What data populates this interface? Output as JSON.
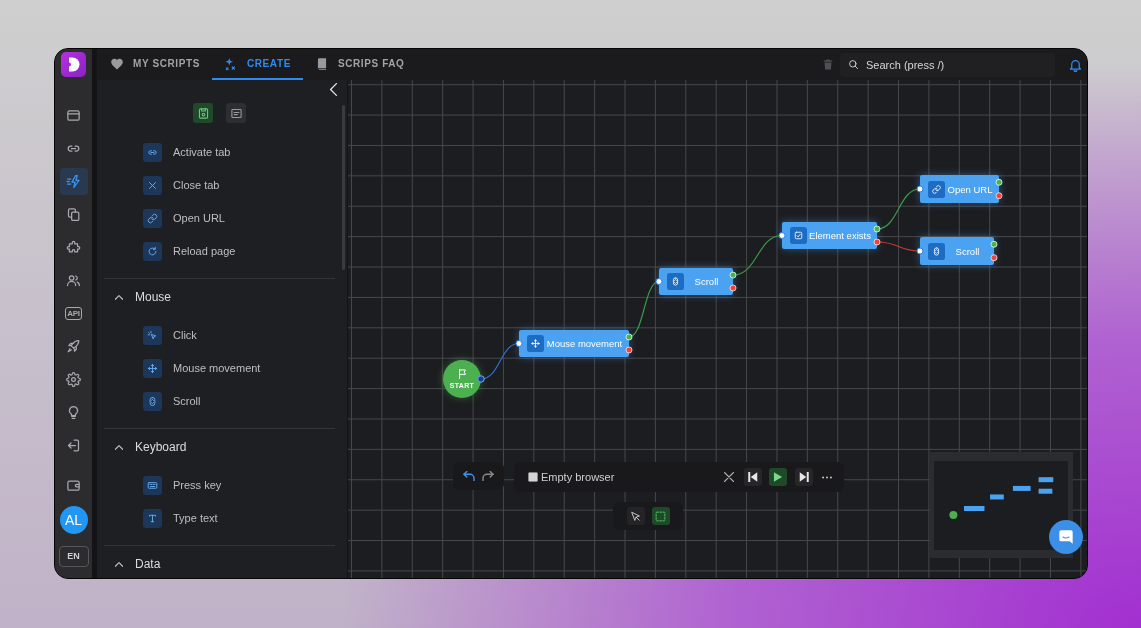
{
  "rail": {
    "items": [
      {
        "kind": "window",
        "selected": false
      },
      {
        "kind": "link",
        "selected": false
      },
      {
        "kind": "lightning",
        "selected": true
      },
      {
        "kind": "copy",
        "selected": false
      },
      {
        "kind": "puzzle",
        "selected": false
      },
      {
        "kind": "users",
        "selected": false
      },
      {
        "kind": "api",
        "label": "API",
        "selected": false
      },
      {
        "kind": "rocket",
        "selected": false
      },
      {
        "kind": "gear",
        "selected": false
      },
      {
        "kind": "bulb",
        "selected": false
      },
      {
        "kind": "logout",
        "selected": false
      }
    ],
    "footer_items": [
      {
        "kind": "wallet",
        "selected": false
      }
    ],
    "avatar": "AL",
    "language": "EN"
  },
  "tabs": [
    {
      "kind": "heart",
      "label": "MY SCRIPTS",
      "selected": false
    },
    {
      "kind": "sparkle",
      "label": "CREATE",
      "selected": true
    },
    {
      "kind": "book",
      "label": "SCRIPS FAQ",
      "selected": false
    }
  ],
  "search": {
    "placeholder": "Search (press /)"
  },
  "panel": {
    "tools": [
      {
        "kind": "save",
        "selected": true
      },
      {
        "kind": "notes",
        "selected": false
      }
    ],
    "sections": [
      {
        "items": [
          {
            "kind": "link",
            "label": "Activate tab"
          },
          {
            "kind": "close",
            "label": "Close tab"
          },
          {
            "kind": "chain",
            "label": "Open URL"
          },
          {
            "kind": "reload",
            "label": "Reload page"
          }
        ]
      },
      {
        "title": "Mouse",
        "expanded": true,
        "items": [
          {
            "kind": "click",
            "label": "Click"
          },
          {
            "kind": "move",
            "label": "Mouse movement"
          },
          {
            "kind": "scroll",
            "label": "Scroll"
          }
        ]
      },
      {
        "title": "Keyboard",
        "expanded": true,
        "items": [
          {
            "kind": "keyboard",
            "label": "Press key"
          },
          {
            "kind": "text",
            "label": "Type text"
          }
        ]
      },
      {
        "title": "Data",
        "expanded": true
      }
    ]
  },
  "canvas": {
    "flow": {
      "kind": "start",
      "label": "START",
      "next": {
        "kind": "mouse-movement",
        "label": "Mouse movement",
        "success": {
          "kind": "scroll",
          "label": "Scroll",
          "success": {
            "kind": "element-exists",
            "label": "Element exists",
            "success": {
              "kind": "open-url",
              "label": "Open URL"
            },
            "failure": {
              "kind": "scroll",
              "label": "Scroll"
            }
          }
        }
      }
    },
    "history": [
      {
        "kind": "undo",
        "disabled": false
      },
      {
        "kind": "redo",
        "disabled": true
      }
    ],
    "browser": {
      "label": "Empty browser",
      "checked": false
    },
    "tools": [
      {
        "kind": "pointer",
        "selected": false
      },
      {
        "kind": "select-area",
        "selected": true
      }
    ]
  }
}
